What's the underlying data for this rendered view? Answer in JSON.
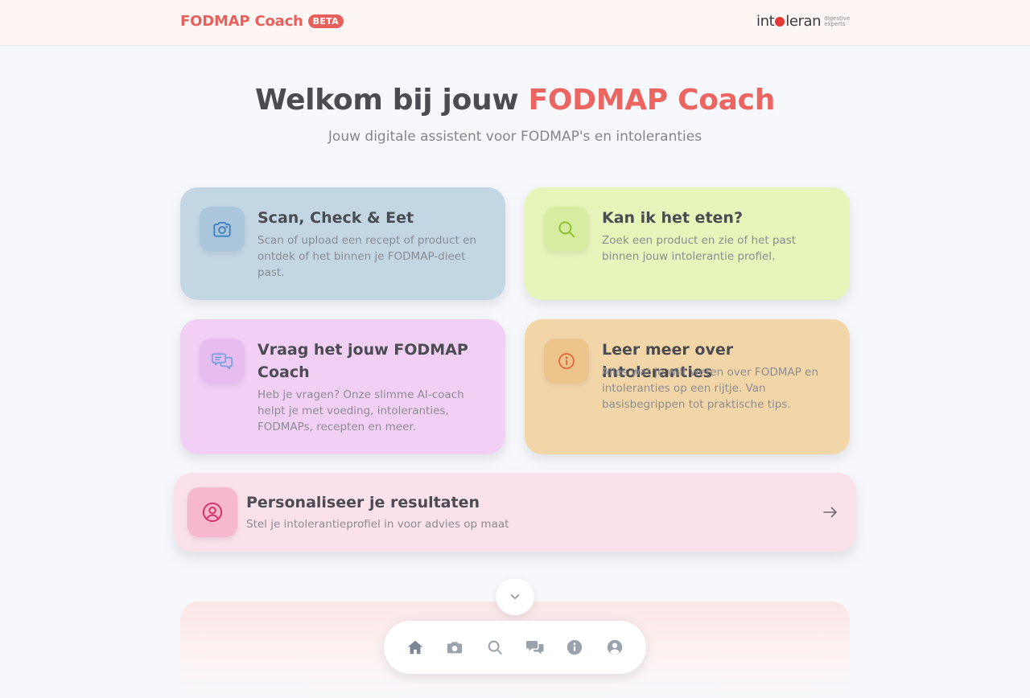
{
  "header": {
    "brand": "FODMAP Coach",
    "badge": "BETA",
    "partner_logo_text": "intoleran",
    "partner_tagline": "digestive experts"
  },
  "hero": {
    "title_prefix": "Welkom bij jouw ",
    "title_accent": "FODMAP Coach",
    "subtitle": "Jouw digitale assistent voor FODMAP's en intoleranties"
  },
  "cards": {
    "scan": {
      "icon": "camera-icon",
      "title": "Scan, Check & Eet",
      "description": "Scan of upload een recept of product en ontdek of het binnen je FODMAP-dieet past."
    },
    "eat": {
      "icon": "search-icon",
      "title": "Kan ik het eten?",
      "description": "Zoek een product en zie of het past binnen jouw intolerantie profiel."
    },
    "chat": {
      "icon": "chat-bubbles-icon",
      "title": "Vraag het jouw FODMAP Coach",
      "description": "Heb je vragen? Onze slimme AI-coach helpt je met voeding, intoleranties, FODMAPs, recepten en meer."
    },
    "learn": {
      "icon": "info-icon",
      "title": "Leer meer over intoleranties",
      "description": "Alles wat je wilt weten over FODMAP en intoleranties op een rijtje. Van basisbegrippen tot praktische tips."
    },
    "personal": {
      "icon": "user-circle-icon",
      "title": "Personaliseer je resultaten",
      "description": "Stel je intolerantieprofiel in voor advies op maat"
    }
  },
  "bottom_nav": {
    "items": [
      "home-icon",
      "camera-icon",
      "search-icon",
      "chat-icon",
      "info-icon",
      "profile-icon"
    ]
  },
  "colors": {
    "brand": "#e8605c",
    "scan_bg": "#c3d6e3",
    "eat_bg": "#e6f5b9",
    "chat_bg": "#f2d0f6",
    "learn_bg": "#f3d6a8",
    "personal_bg": "#fbe1ea"
  }
}
